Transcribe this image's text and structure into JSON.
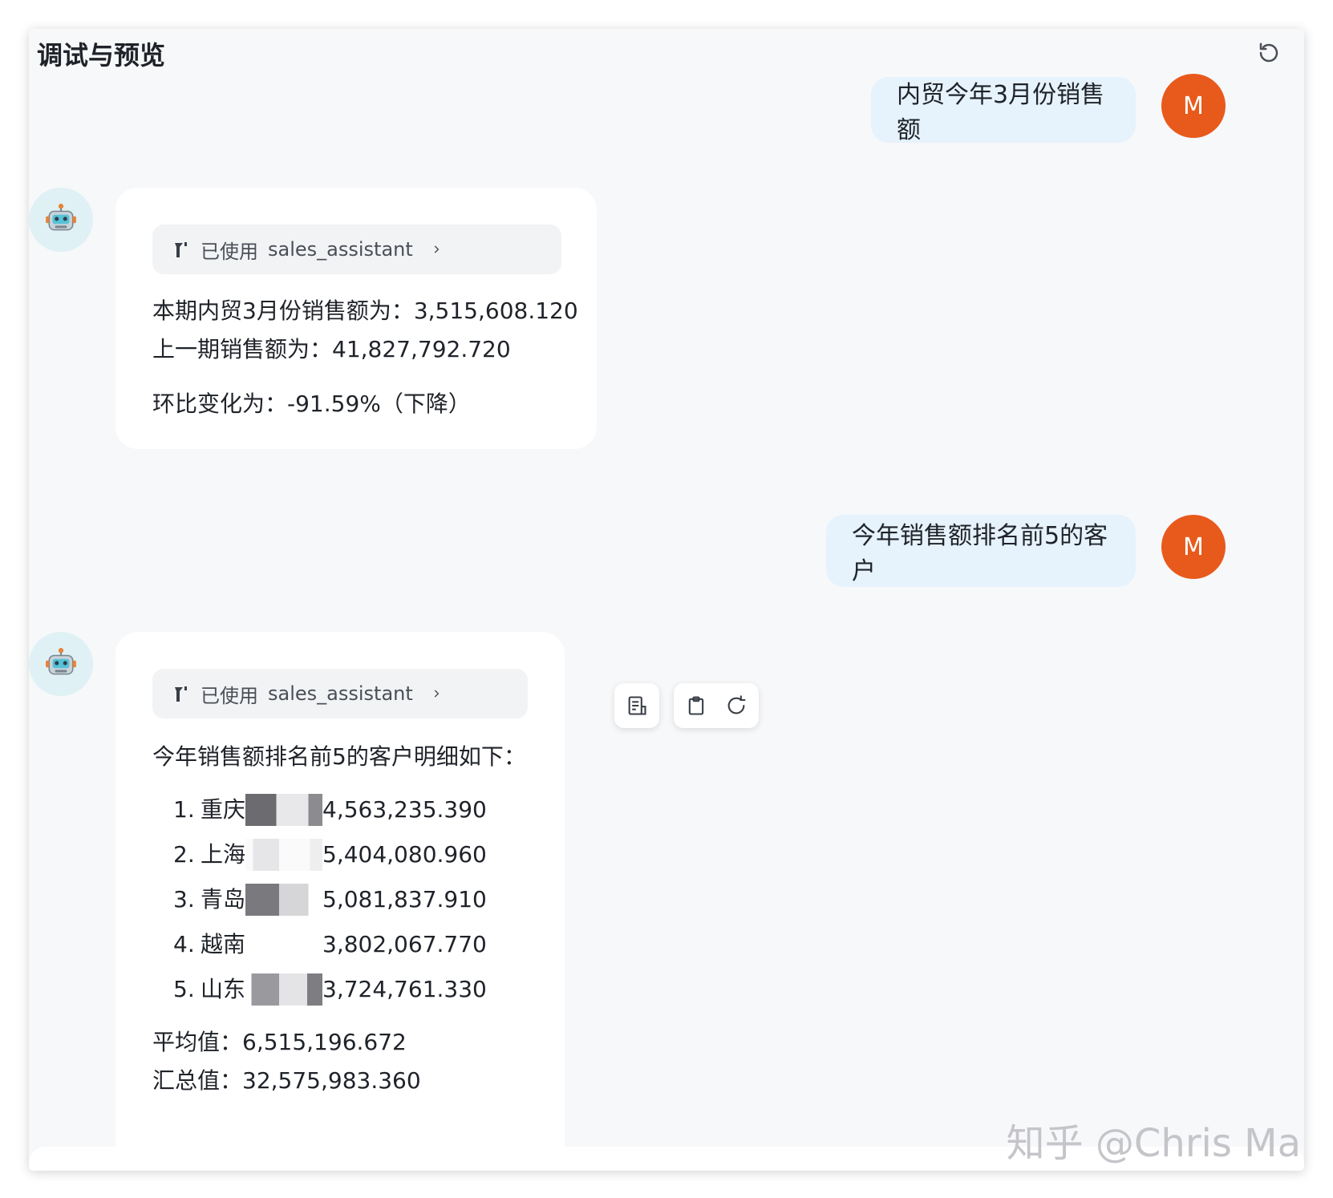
{
  "header": {
    "title": "调试与预览"
  },
  "messages": {
    "q1": {
      "text": "内贸今年3月份销售额",
      "avatar": "M"
    },
    "a1": {
      "tool": {
        "prefix": "已使用",
        "name": "sales_assistant"
      },
      "line1": "本期内贸3月份销售额为：3,515,608.120",
      "line2": "上一期销售额为：41,827,792.720",
      "line3": "环比变化为：-91.59%（下降）"
    },
    "q2": {
      "text": "今年销售额排名前5的客户",
      "avatar": "M"
    },
    "a2": {
      "tool": {
        "prefix": "已使用",
        "name": "sales_assistant"
      },
      "intro": "今年销售额排名前5的客户明细如下：",
      "ranking": [
        {
          "num": "1.",
          "city": "重庆",
          "value": "4,563,235.390"
        },
        {
          "num": "2.",
          "city": "上海",
          "value": "5,404,080.960"
        },
        {
          "num": "3.",
          "city": "青岛",
          "value": "5,081,837.910"
        },
        {
          "num": "4.",
          "city": "越南",
          "value": "3,802,067.770"
        },
        {
          "num": "5.",
          "city": "山东",
          "value": "3,724,761.330"
        }
      ],
      "average": "平均值：6,515,196.672",
      "total": "汇总值：32,575,983.360"
    }
  },
  "watermark": "知乎 @Chris Ma",
  "colors": {
    "user_avatar": "#e85a1b",
    "user_bubble": "#e6f2fc",
    "bot_avatar_bg": "#dff1f4"
  }
}
